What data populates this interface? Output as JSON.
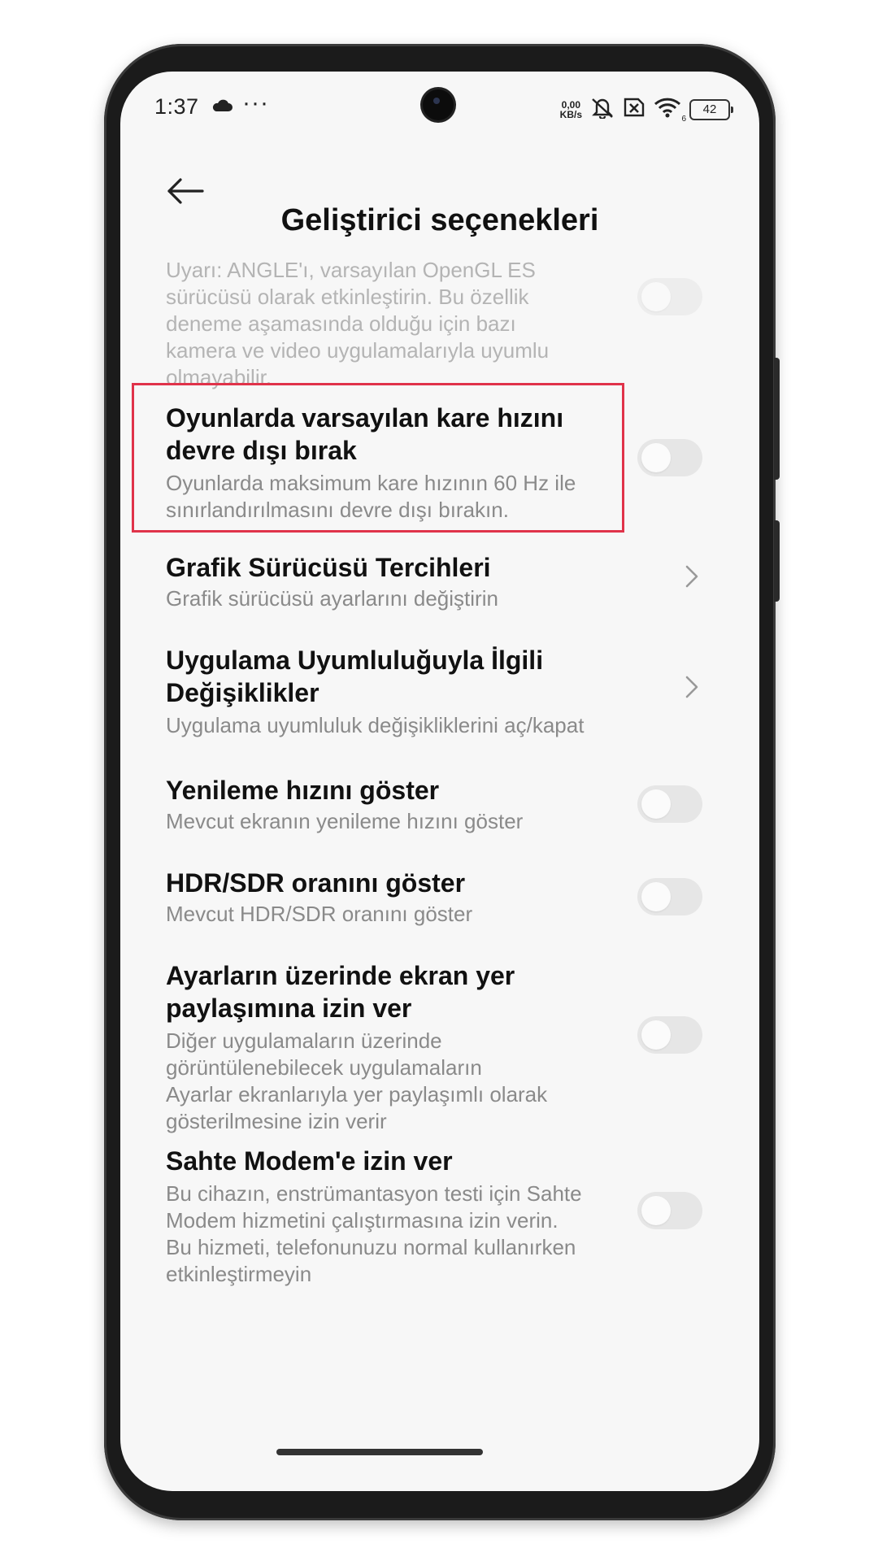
{
  "status_bar": {
    "time": "1:37",
    "more_indicator": "···",
    "net_speed_value": "0,00",
    "net_speed_unit": "KB/s",
    "wifi_label": "6",
    "battery": "42",
    "icons": [
      "cloud-icon",
      "mute-icon",
      "sim-error-icon",
      "wifi-icon",
      "battery-icon"
    ]
  },
  "header": {
    "title": "Geliştirici seçenekleri",
    "back_icon": "back-arrow-icon"
  },
  "settings": [
    {
      "id": "angle",
      "title": "",
      "subtitle_lines": [
        "Uyarı: ANGLE'ı, varsayılan OpenGL ES",
        "sürücüsü olarak etkinleştirin. Bu özellik",
        "deneme aşamasında olduğu için bazı",
        "kamera ve video uygulamalarıyla uyumlu",
        "olmayabilir."
      ],
      "control": "toggle",
      "enabled": false
    },
    {
      "id": "game-frame-rate",
      "title_lines": [
        "Oyunlarda varsayılan kare hızını",
        "devre dışı bırak"
      ],
      "subtitle_lines": [
        "Oyunlarda maksimum kare hızının 60 Hz ile",
        "sınırlandırılmasını devre dışı bırakın."
      ],
      "control": "toggle",
      "enabled": false,
      "highlighted": true
    },
    {
      "id": "graphics-driver",
      "title_lines": [
        "Grafik Sürücüsü Tercihleri"
      ],
      "subtitle_lines": [
        "Grafik sürücüsü ayarlarını değiştirin"
      ],
      "control": "chevron"
    },
    {
      "id": "app-compat",
      "title_lines": [
        "Uygulama Uyumluluğuyla İlgili",
        "Değişiklikler"
      ],
      "subtitle_lines": [
        "Uygulama uyumluluk değişikliklerini aç/kapat"
      ],
      "control": "chevron"
    },
    {
      "id": "refresh-rate",
      "title_lines": [
        "Yenileme hızını göster"
      ],
      "subtitle_lines": [
        "Mevcut ekranın yenileme hızını göster"
      ],
      "control": "toggle",
      "enabled": false
    },
    {
      "id": "hdr-sdr",
      "title_lines": [
        "HDR/SDR oranını göster"
      ],
      "subtitle_lines": [
        "Mevcut HDR/SDR oranını göster"
      ],
      "control": "toggle",
      "enabled": false
    },
    {
      "id": "screen-share-overlay",
      "title_lines": [
        "Ayarların üzerinde ekran yer",
        "paylaşımına izin ver"
      ],
      "subtitle_lines": [
        "Diğer uygulamaların üzerinde",
        "görüntülenebilecek uygulamaların",
        "Ayarlar ekranlarıyla yer paylaşımlı olarak",
        "gösterilmesine izin verir"
      ],
      "control": "toggle",
      "enabled": false
    },
    {
      "id": "mock-modem",
      "title_lines": [
        "Sahte Modem'e izin ver"
      ],
      "subtitle_lines": [
        "Bu cihazın, enstrümantasyon testi için Sahte",
        "Modem hizmetini çalıştırmasına izin verin.",
        "Bu hizmeti, telefonunuzu normal kullanırken",
        "etkinleştirmeyin"
      ],
      "control": "toggle",
      "enabled": false
    }
  ],
  "colors": {
    "highlight_border": "#e0334a",
    "toggle_off_track": "#e6e6e6",
    "title_text": "#111111",
    "subtitle_text": "#8a8a8a",
    "screen_bg": "#f7f7f7"
  }
}
